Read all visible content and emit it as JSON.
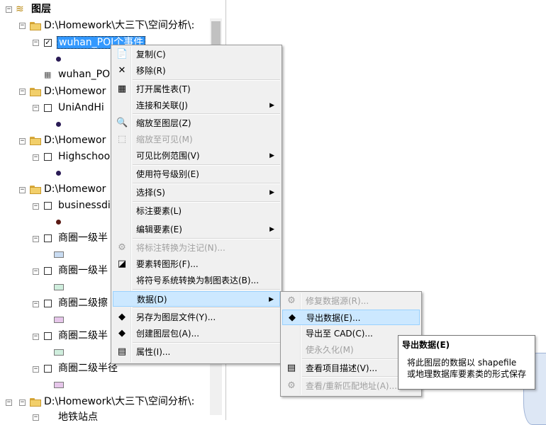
{
  "toc": {
    "root_label": "图层",
    "groups": [
      {
        "path": "D:\\Homework\\大三下\\空间分析\\:"
      },
      {
        "path": "D:\\Homewor"
      },
      {
        "path": "D:\\Homewor"
      },
      {
        "path": "D:\\Homewor"
      },
      {
        "path": "D:\\Homework\\大三下\\空间分析\\:"
      }
    ],
    "layers": {
      "poi": "wuhan_POI个事件",
      "poi_table": "wuhan_PO",
      "uni": "UniAndHi",
      "high": "Highschoo",
      "biz": "businessdi",
      "c1": "商圈一级半",
      "c2": "商圈一级半",
      "c3": "商圈二级擦",
      "c4": "商圈二级半",
      "c5": "商圈二级半径",
      "metro": "地铁站点"
    },
    "colors": {
      "c1": "#c9dcf2",
      "c2": "#cfeedd",
      "c3": "#e6c6ea",
      "c4": "#cfeedd",
      "c5": "#e6c6ea"
    }
  },
  "context_menu": {
    "items": [
      {
        "icon": "copy-icon",
        "glyph": "📄",
        "label": "复制(C)"
      },
      {
        "icon": "remove-icon",
        "glyph": "✕",
        "label": "移除(R)"
      },
      {
        "icon": "table-icon",
        "glyph": "▦",
        "label": "打开属性表(T)"
      },
      {
        "icon": "",
        "glyph": "",
        "label": "连接和关联(J)"
      },
      {
        "icon": "zoom-layer-icon",
        "glyph": "🔍",
        "label": "缩放至图层(Z)"
      },
      {
        "icon": "zoom-visible-icon",
        "glyph": "⬚",
        "label": "缩放至可见(M)"
      },
      {
        "icon": "",
        "glyph": "",
        "label": "可见比例范围(V)"
      },
      {
        "icon": "",
        "glyph": "",
        "label": "使用符号级别(E)"
      },
      {
        "icon": "",
        "glyph": "",
        "label": "选择(S)"
      },
      {
        "icon": "",
        "glyph": "",
        "label": "标注要素(L)"
      },
      {
        "icon": "",
        "glyph": "",
        "label": "编辑要素(E)"
      },
      {
        "icon": "annotation-icon",
        "glyph": "⚙",
        "label": "将标注转换为注记(N)..."
      },
      {
        "icon": "feature-graphics-icon",
        "glyph": "◪",
        "label": "要素转图形(F)..."
      },
      {
        "icon": "",
        "glyph": "",
        "label": "将符号系统转换为制图表达(B)..."
      },
      {
        "icon": "",
        "glyph": "",
        "label": "数据(D)"
      },
      {
        "icon": "layer-file-icon",
        "glyph": "◆",
        "label": "另存为图层文件(Y)..."
      },
      {
        "icon": "layer-package-icon",
        "glyph": "◆",
        "label": "创建图层包(A)..."
      },
      {
        "icon": "properties-icon",
        "glyph": "▤",
        "label": "属性(I)..."
      }
    ]
  },
  "data_submenu": {
    "items": [
      {
        "icon": "repair-source-icon",
        "glyph": "⚙",
        "label": "修复数据源(R)..."
      },
      {
        "icon": "export-data-icon",
        "glyph": "◆",
        "label": "导出数据(E)..."
      },
      {
        "icon": "",
        "glyph": "",
        "label": "导出至 CAD(C)..."
      },
      {
        "icon": "",
        "glyph": "",
        "label": "使永久化(M)"
      },
      {
        "icon": "item-description-icon",
        "glyph": "▤",
        "label": "查看项目描述(V)..."
      },
      {
        "icon": "rematch-icon",
        "glyph": "⚙",
        "label": "查看/重新匹配地址(A)..."
      }
    ]
  },
  "tooltip": {
    "title": "导出数据(E)",
    "line1": "将此图层的数据以 shapefile",
    "line2": "或地理数据库要素类的形式保存"
  },
  "glyphs": {
    "collapse": "−",
    "check": "✓",
    "submenu_arrow": "▶",
    "root_icon": "≋"
  }
}
